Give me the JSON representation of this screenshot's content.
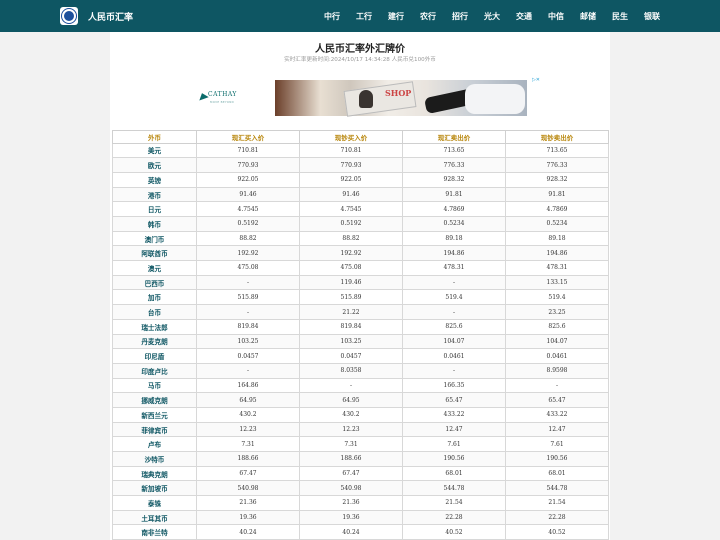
{
  "header": {
    "brand_title": "人民币汇率",
    "nav": [
      "中行",
      "工行",
      "建行",
      "农行",
      "招行",
      "光大",
      "交通",
      "中信",
      "邮储",
      "民生",
      "银联"
    ]
  },
  "main": {
    "title": "人民币汇率外汇牌价",
    "subtitle": "实时汇率更新时间:2024/10/17 14:34:28 人民币兑100外币"
  },
  "ad": {
    "brand": "CATHAY",
    "tagline": "MOVE BEYOND",
    "photo_text": "SHOP",
    "choice_icon": "ad-choices-icon"
  },
  "table": {
    "headers": [
      "外币",
      "现汇买入价",
      "现钞买入价",
      "现汇卖出价",
      "现钞卖出价"
    ],
    "rows": [
      [
        "美元",
        "710.81",
        "710.81",
        "713.65",
        "713.65"
      ],
      [
        "欧元",
        "770.93",
        "770.93",
        "776.33",
        "776.33"
      ],
      [
        "英镑",
        "922.05",
        "922.05",
        "928.32",
        "928.32"
      ],
      [
        "港币",
        "91.46",
        "91.46",
        "91.81",
        "91.81"
      ],
      [
        "日元",
        "4.7545",
        "4.7545",
        "4.7869",
        "4.7869"
      ],
      [
        "韩币",
        "0.5192",
        "0.5192",
        "0.5234",
        "0.5234"
      ],
      [
        "澳门币",
        "88.82",
        "88.82",
        "89.18",
        "89.18"
      ],
      [
        "阿联酋币",
        "192.92",
        "192.92",
        "194.86",
        "194.86"
      ],
      [
        "澳元",
        "475.08",
        "475.08",
        "478.31",
        "478.31"
      ],
      [
        "巴西币",
        "-",
        "119.46",
        "-",
        "133.15"
      ],
      [
        "加币",
        "515.89",
        "515.89",
        "519.4",
        "519.4"
      ],
      [
        "台币",
        "-",
        "21.22",
        "-",
        "23.25"
      ],
      [
        "瑞士法郎",
        "819.84",
        "819.84",
        "825.6",
        "825.6"
      ],
      [
        "丹麦克朗",
        "103.25",
        "103.25",
        "104.07",
        "104.07"
      ],
      [
        "印尼盾",
        "0.0457",
        "0.0457",
        "0.0461",
        "0.0461"
      ],
      [
        "印度卢比",
        "-",
        "8.0358",
        "-",
        "8.9598"
      ],
      [
        "马币",
        "164.86",
        "-",
        "166.35",
        "-"
      ],
      [
        "挪威克朗",
        "64.95",
        "64.95",
        "65.47",
        "65.47"
      ],
      [
        "新西兰元",
        "430.2",
        "430.2",
        "433.22",
        "433.22"
      ],
      [
        "菲律宾币",
        "12.23",
        "12.23",
        "12.47",
        "12.47"
      ],
      [
        "卢布",
        "7.31",
        "7.31",
        "7.61",
        "7.61"
      ],
      [
        "沙特币",
        "188.66",
        "188.66",
        "190.56",
        "190.56"
      ],
      [
        "瑞典克朗",
        "67.47",
        "67.47",
        "68.01",
        "68.01"
      ],
      [
        "新加坡币",
        "540.98",
        "540.98",
        "544.78",
        "544.78"
      ],
      [
        "泰铢",
        "21.36",
        "21.36",
        "21.54",
        "21.54"
      ],
      [
        "土耳其币",
        "19.36",
        "19.36",
        "22.28",
        "22.28"
      ],
      [
        "南非兰特",
        "40.24",
        "40.24",
        "40.52",
        "40.52"
      ]
    ]
  }
}
